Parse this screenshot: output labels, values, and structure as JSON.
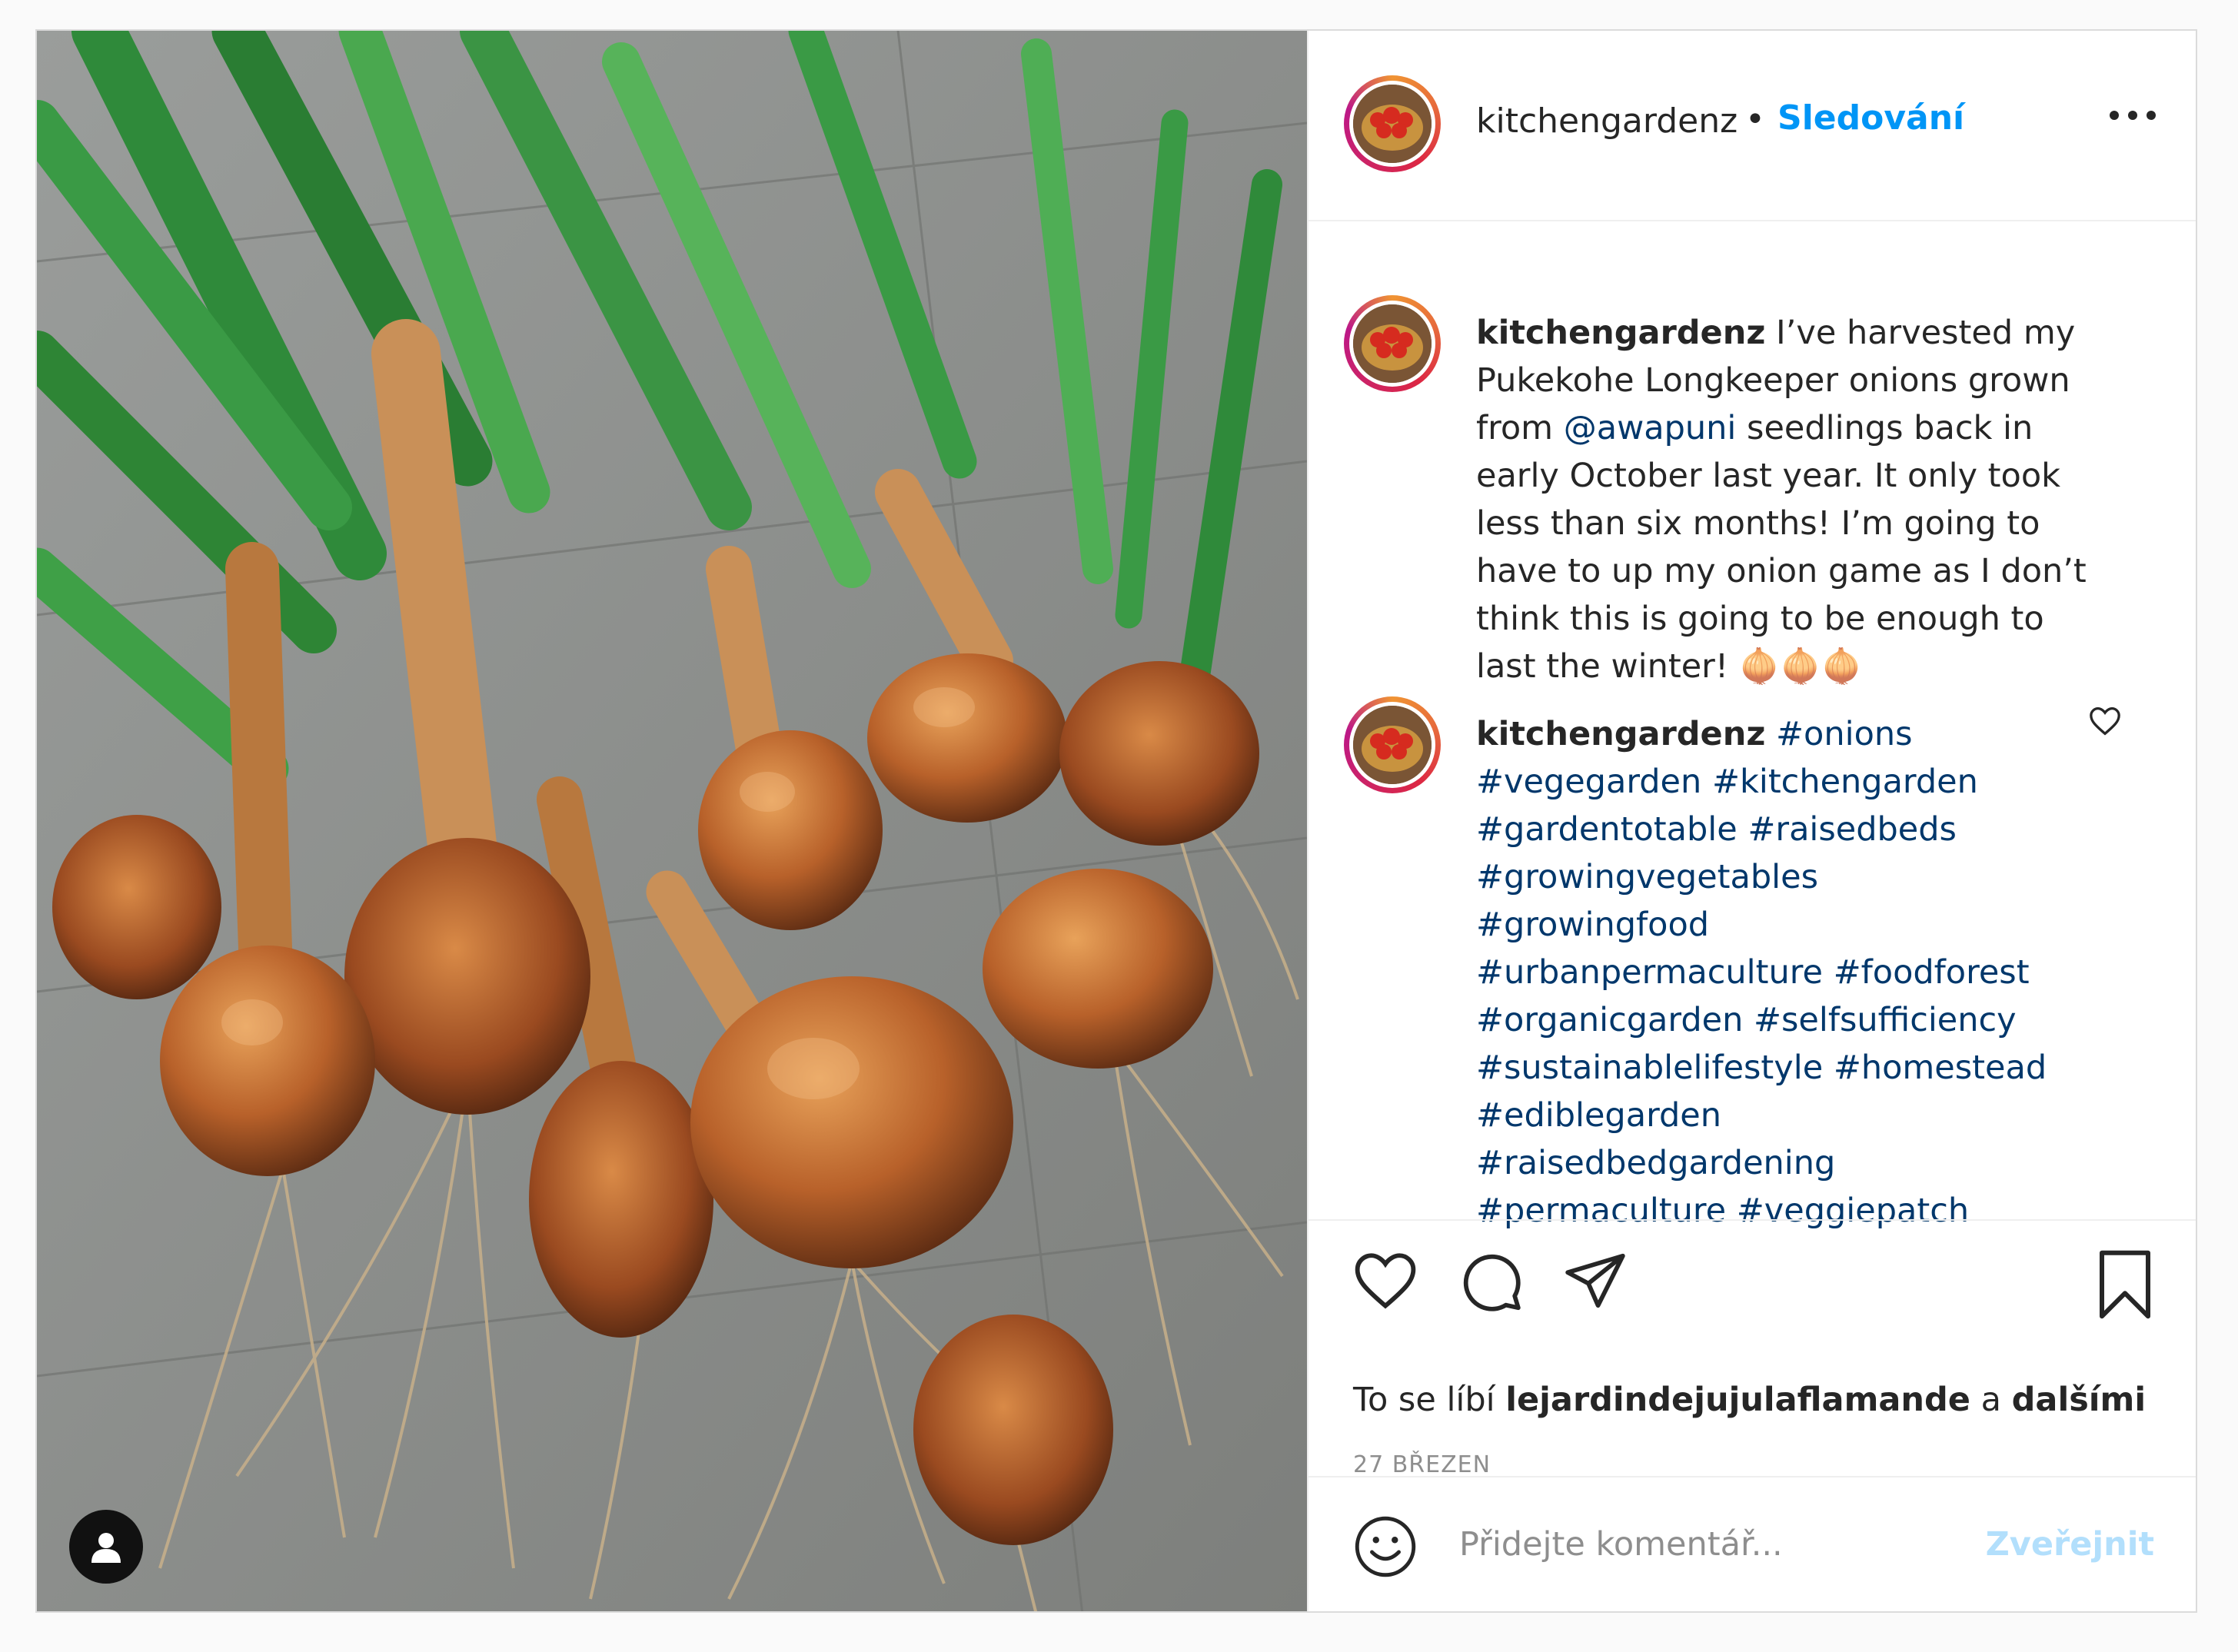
{
  "post": {
    "username": "kitchengardenz",
    "separator": "•",
    "follow_label": "Sledování",
    "more_icon": "more-horizontal-icon"
  },
  "comments": [
    {
      "username": "kitchengardenz",
      "text": "I’ve harvested my Pukekohe Longkeeper onions grown from",
      "mention": "@awapuni",
      "text_after": "seedlings back in early October last year. It only took less than six months! I’m going to have to up my onion game as I don’t think this is going to be enough to last the winter!",
      "emoji": "🧅🧅🧅"
    },
    {
      "username": "kitchengardenz",
      "hashtags": [
        "#onions",
        "#vegegarden",
        "#kitchengarden",
        "#gardentotable",
        "#raisedbeds",
        "#growingvegetables",
        "#growingfood",
        "#urbanpermaculture",
        "#foodforest",
        "#organicgarden",
        "#selfsufficiency",
        "#sustainablelifestyle",
        "#homestead",
        "#ediblegarden",
        "#raisedbedgardening",
        "#permaculture",
        "#veggiepatch"
      ]
    }
  ],
  "actions": {
    "like_icon": "heart-icon",
    "comment_icon": "comment-icon",
    "share_icon": "paper-plane-icon",
    "save_icon": "bookmark-icon"
  },
  "likes": {
    "prefix": "To se líbí",
    "user": "lejardindejujulaflamande",
    "middle": "a",
    "others": "dalšími"
  },
  "date": "27 BŘEZEN",
  "add_comment": {
    "placeholder": "Přidejte komentář...",
    "post_label": "Zveřejnit",
    "emoji_icon": "smiley-icon"
  },
  "colors": {
    "link_blue": "#0095f6",
    "hashtag": "#00376b",
    "post_disabled": "#b2dffc",
    "muted": "#8e8e8e"
  }
}
